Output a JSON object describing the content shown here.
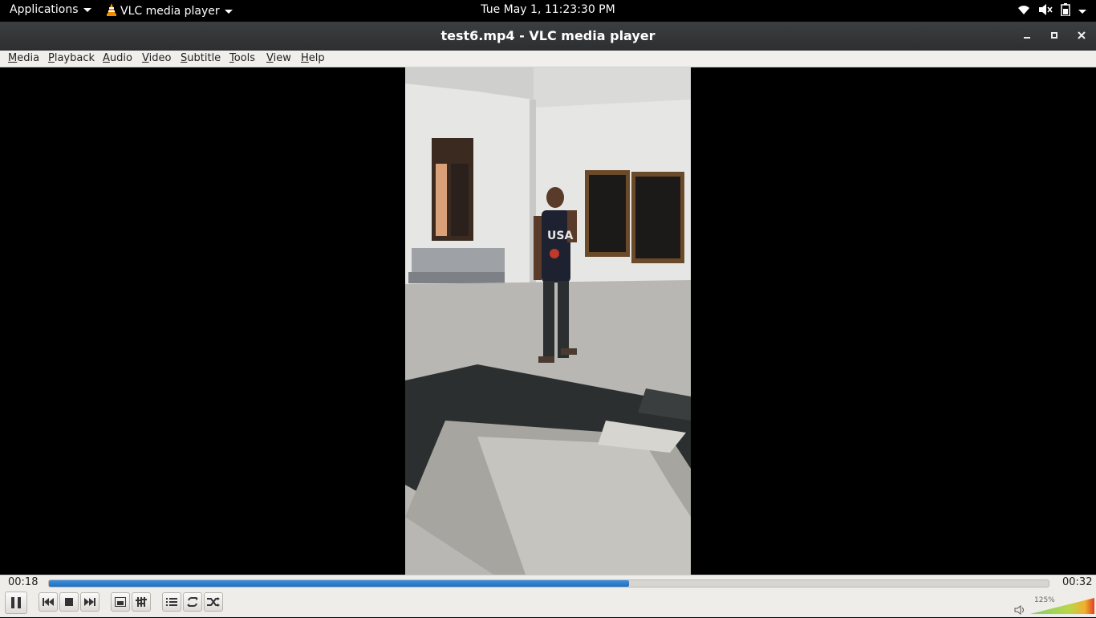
{
  "topbar": {
    "applications_label": "Applications",
    "app_name": "VLC media player",
    "clock": "Tue May  1, 11:23:30 PM"
  },
  "window": {
    "title": "test6.mp4 - VLC media player"
  },
  "menu": {
    "items": [
      "Media",
      "Playback",
      "Audio",
      "Video",
      "Subtitle",
      "Tools",
      "View",
      "Help"
    ]
  },
  "player": {
    "elapsed": "00:18",
    "total": "00:32",
    "progress_fraction": 0.58,
    "volume_label": "125%",
    "volume_fraction": 1.0
  },
  "icons": {
    "vlc": "vlc-cone-icon",
    "wifi": "wifi-icon",
    "volume_muted": "volume-muted-icon",
    "battery": "battery-icon",
    "system_menu": "chevron-down-icon"
  },
  "colors": {
    "progress": "#1f6fc0",
    "topbar": "#000000",
    "titlebar": "#2c2e30",
    "vlc_orange": "#f28c00"
  }
}
